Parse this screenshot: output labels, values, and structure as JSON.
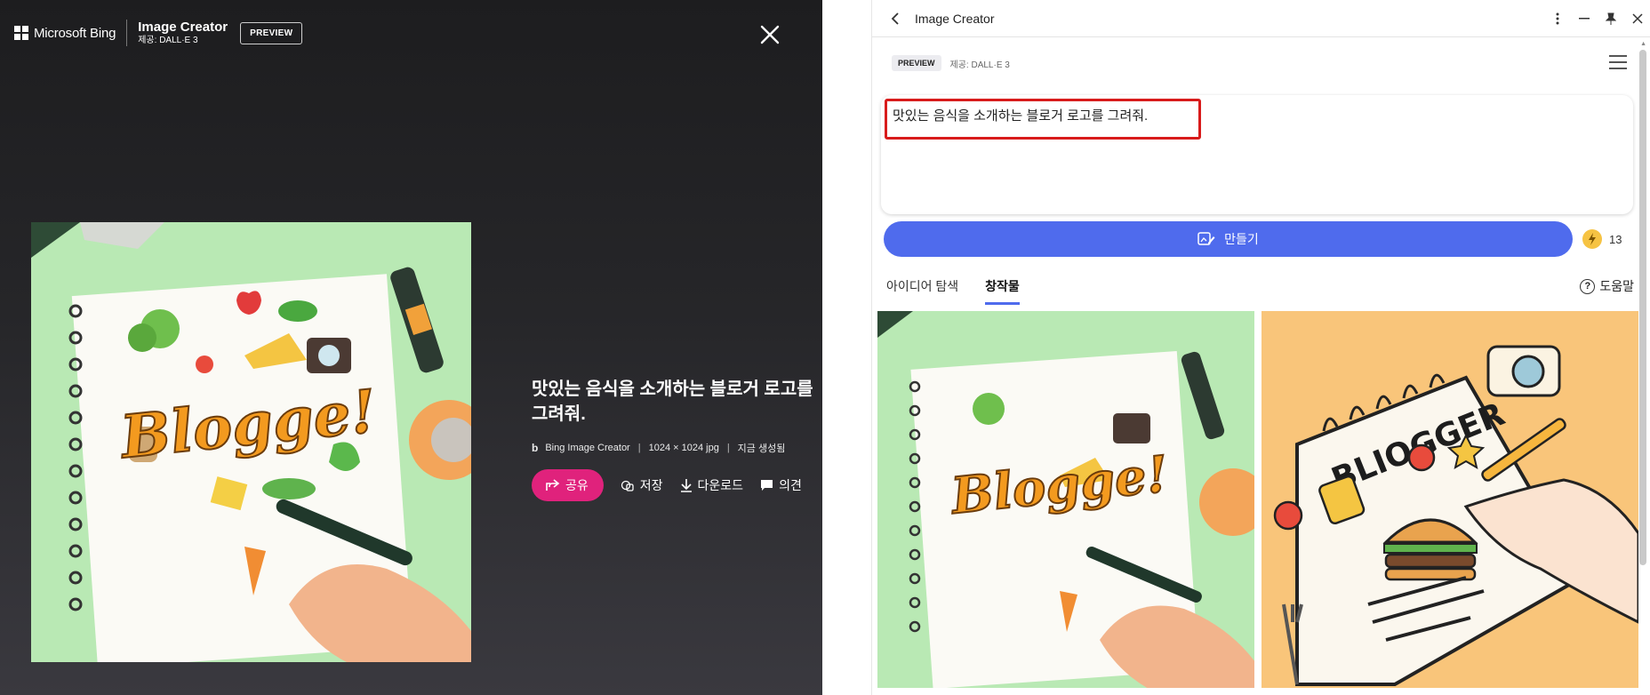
{
  "viewer": {
    "brand_name": "Microsoft Bing",
    "app_title": "Image Creator",
    "provider": "제공: DALL·E 3",
    "preview_label": "PREVIEW",
    "prompt": "맛있는 음식을 소개하는 블로거 로고를 그려줘.",
    "meta": {
      "source": "Bing Image Creator",
      "dimensions": "1024 × 1024 jpg",
      "status": "지금 생성됨"
    },
    "actions": {
      "share": "공유",
      "save": "저장",
      "download": "다운로드",
      "feedback": "의견"
    },
    "image_text": "Blogge!"
  },
  "panel": {
    "title": "Image Creator",
    "preview_badge": "PREVIEW",
    "provider": "제공: DALL·E 3",
    "prompt_value": "맛있는 음식을 소개하는 블로거 로고를 그려줘.",
    "create_label": "만들기",
    "boost_count": "13",
    "tabs": [
      {
        "label": "아이디어 탐색",
        "active": false
      },
      {
        "label": "창작물",
        "active": true
      }
    ],
    "help_label": "도움말",
    "thumbnails": [
      {
        "text": "Blogge!"
      },
      {
        "text": "BLIOGGER"
      }
    ]
  },
  "colors": {
    "accent": "#4f6bed",
    "share_pink": "#e0227c",
    "highlight_red": "#d81b1b",
    "viewer_bg": "#262629"
  },
  "icons": {
    "close": "close-icon",
    "share": "share-icon",
    "save": "save-icon",
    "download": "download-icon",
    "feedback": "comment-icon",
    "back": "chevron-left-icon",
    "more": "more-vertical-icon",
    "minimize": "minimize-icon",
    "pin": "pin-icon",
    "boost": "lightning-icon",
    "help": "question-circle-icon",
    "menu": "hamburger-menu-icon",
    "create": "edit-image-icon"
  }
}
